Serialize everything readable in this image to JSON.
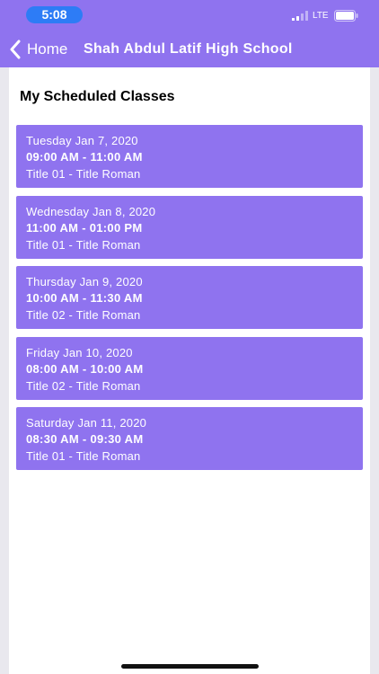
{
  "status_bar": {
    "time": "5:08",
    "network": "LTE"
  },
  "nav": {
    "back_label": "Home",
    "title": "Shah Abdul Latif High School"
  },
  "section": {
    "title": "My Scheduled Classes"
  },
  "classes": [
    {
      "date": "Tuesday Jan 7, 2020",
      "time": "09:00 AM - 11:00 AM",
      "title": "Title 01 - Title Roman"
    },
    {
      "date": "Wednesday Jan 8, 2020",
      "time": "11:00 AM - 01:00 PM",
      "title": "Title 01 - Title Roman"
    },
    {
      "date": "Thursday Jan 9, 2020",
      "time": "10:00 AM - 11:30 AM",
      "title": "Title 02 - Title Roman"
    },
    {
      "date": "Friday Jan 10, 2020",
      "time": "08:00 AM - 10:00 AM",
      "title": "Title 02 - Title Roman"
    },
    {
      "date": "Saturday Jan 11, 2020",
      "time": "08:30 AM - 09:30 AM",
      "title": "Title 01 - Title Roman"
    }
  ],
  "colors": {
    "accent": "#8f73ef",
    "time_pill": "#2d7cf6",
    "background": "#e9e8ee"
  },
  "icons": {
    "back": "chevron-left-icon",
    "signal": "signal-icon",
    "battery": "battery-icon"
  }
}
